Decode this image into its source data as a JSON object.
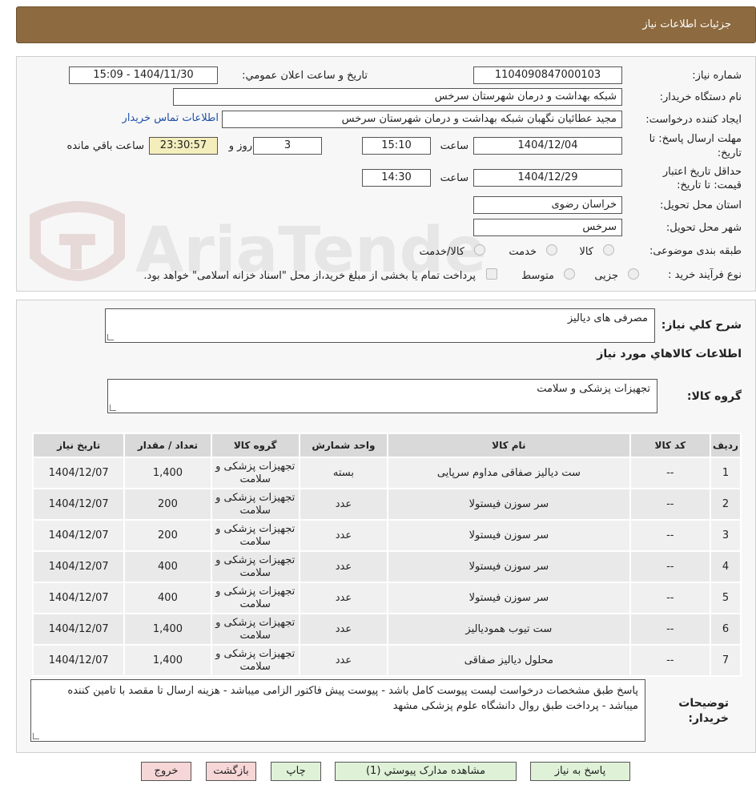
{
  "header": {
    "title": "جزئیات اطلاعات نیاز"
  },
  "watermark": {
    "text": "AriaTender.neT"
  },
  "form": {
    "need_number_label": "شماره نیاز:",
    "need_number": "1104090847000103",
    "announce_label": "تاریخ و ساعت اعلان عمومي:",
    "announce_value": "1404/11/30 - 15:09",
    "buyer_org_label": "نام دستگاه خريدار:",
    "buyer_org": "شبکه بهداشت و درمان شهرستان سرخس",
    "creator_label": "ایجاد کننده درخواست:",
    "creator": "مجید عطائیان نگهبان شبکه بهداشت و درمان شهرستان سرخس",
    "contact_link": "اطلاعات تماس خریدار",
    "deadline_label_1": "مهلت ارسال پاسخ: تا",
    "deadline_label_2": "تاریخ:",
    "deadline_date": "1404/12/04",
    "time_label": "ساعت",
    "deadline_time": "15:10",
    "days": "3",
    "days_label": "روز و",
    "remaining": "23:30:57",
    "remaining_label": "ساعت باقي مانده",
    "validity_label_1": "حداقل تاریخ اعتبار",
    "validity_label_2": "قیمت: تا تاریخ:",
    "validity_date": "1404/12/29",
    "validity_time": "14:30",
    "province_label": "استان محل تحویل:",
    "province": "خراسان رضوی",
    "city_label": "شهر محل تحویل:",
    "city": "سرخس",
    "category_label": "طبقه بندی موضوعی:",
    "category_options": [
      "کالا",
      "خدمت",
      "کالا/خدمت"
    ],
    "process_label": "نوع فرآیند خرید :",
    "process_options": [
      "جزیی",
      "متوسط"
    ],
    "payment_note": "پرداخت تمام یا بخشی از مبلغ خرید،از محل \"اسناد خزانه اسلامی\" خواهد بود."
  },
  "details": {
    "summary_label": "شرح کلي نیاز:",
    "summary": "مصرفی های دیالیز",
    "goods_info_title": "اطلاعات کالاهاي مورد نیاز",
    "goods_group_label": "گروه کالا:",
    "goods_group": "تجهیزات پزشکی و سلامت"
  },
  "table": {
    "headers": [
      "ردیف",
      "کد کالا",
      "نام کالا",
      "واحد شمارش",
      "گروه کالا",
      "تعداد / مقدار",
      "تاریخ نیاز"
    ],
    "rows": [
      [
        "1",
        "--",
        "ست دیالیز صفاقی مداوم سرپایی",
        "بسته",
        "تجهیزات پزشکی و سلامت",
        "1,400",
        "1404/12/07"
      ],
      [
        "2",
        "--",
        "سر سوزن فیستولا",
        "عدد",
        "تجهیزات پزشکی و سلامت",
        "200",
        "1404/12/07"
      ],
      [
        "3",
        "--",
        "سر سوزن فیستولا",
        "عدد",
        "تجهیزات پزشکی و سلامت",
        "200",
        "1404/12/07"
      ],
      [
        "4",
        "--",
        "سر سوزن فیستولا",
        "عدد",
        "تجهیزات پزشکی و سلامت",
        "400",
        "1404/12/07"
      ],
      [
        "5",
        "--",
        "سر سوزن فیستولا",
        "عدد",
        "تجهیزات پزشکی و سلامت",
        "400",
        "1404/12/07"
      ],
      [
        "6",
        "--",
        "ست تیوب همودیالیز",
        "عدد",
        "تجهیزات پزشکی و سلامت",
        "1,400",
        "1404/12/07"
      ],
      [
        "7",
        "--",
        "محلول دیالیز صفاقی",
        "عدد",
        "تجهیزات پزشکی و سلامت",
        "1,400",
        "1404/12/07"
      ]
    ]
  },
  "notes": {
    "label_1": "توضیحات",
    "label_2": "خریدار:",
    "text": "پاسخ طبق مشخصات درخواست لیست پیوست کامل باشد - پیوست پیش فاکتور الزامی میباشد - هزینه ارسال تا مقصد با تامین کننده میباشد - پرداخت طبق روال دانشگاه علوم پزشکی مشهد"
  },
  "buttons": {
    "reply": "پاسخ به نیاز",
    "attachments": "مشاهده مدارک پیوستي (1)",
    "print": "چاپ",
    "back": "بازگشت",
    "exit": "خروج"
  },
  "colors": {
    "header_bg": "#8d6a40",
    "link": "#1f4fa8",
    "timer_bg": "#f4eebd"
  }
}
